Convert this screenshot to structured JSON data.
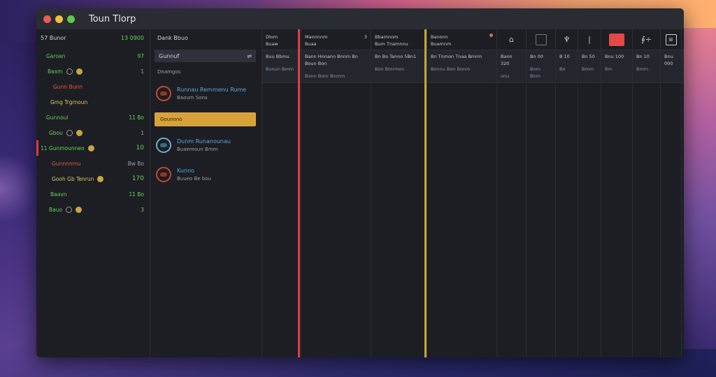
{
  "window": {
    "title": "Toun Tlorp"
  },
  "sidebar": {
    "header_left": "57 Bunor",
    "header_right": "13 0900",
    "items": [
      {
        "label": "Garoan",
        "value": "97",
        "color": "green",
        "icon": ""
      },
      {
        "label": "Baxm",
        "value": "1",
        "color": "green",
        "icon": "dots"
      },
      {
        "label": "Gunn Bunn",
        "value": "",
        "color": "red",
        "icon": ""
      },
      {
        "label": "Gmg Trgrnoun",
        "value": "",
        "color": "yellow",
        "icon": ""
      },
      {
        "label": "Gunnoul",
        "value": "11 Bo",
        "color": "green",
        "icon": ""
      },
      {
        "label": "Gbou",
        "value": "1",
        "color": "green",
        "icon": "dot"
      },
      {
        "label": "11 Gunmounneo",
        "value": "10",
        "color": "green",
        "icon": "dot"
      },
      {
        "label": "Gunnnnmu",
        "value": "Bw Bo",
        "color": "red",
        "icon": ""
      },
      {
        "label": "Gooh Gb Tenrun",
        "value": "170",
        "color": "yellow",
        "icon": "dot"
      },
      {
        "label": "Baavn",
        "value": "11 Bo",
        "color": "green",
        "icon": ""
      },
      {
        "label": "Bauo",
        "value": "3",
        "color": "green",
        "icon": "dots"
      }
    ]
  },
  "middle": {
    "header": "Dank Bbuo",
    "search_value": "Gunnuf",
    "subtitle": "Dnamgos",
    "cards": [
      {
        "title": "Runnau Remmenu Rume",
        "sub": "Baoum Sons"
      },
      {
        "title": "Dunm Runanounau",
        "sub": "Buaemoun Bmm"
      },
      {
        "title": "Kunno",
        "sub": "Buueo Be bou"
      }
    ],
    "selected_label": "Gounono"
  },
  "grid": {
    "headers": [
      {
        "l1": "Dlom",
        "l2": "Buaw"
      },
      {
        "l1": "Mannnnm",
        "l2": "Buaa",
        "n": "3"
      },
      {
        "l1": "Bbamnom",
        "l2": "Bum Tnamnnu"
      },
      {
        "l1": "Banonn",
        "l2": "Buamnm"
      }
    ],
    "icon_headers": [
      "pin-icon",
      "square-icon",
      "thumb-icon",
      "divider-icon",
      "red-box",
      "formula-icon",
      "sidebar-icon"
    ],
    "row": [
      {
        "t": "Buu Bbmu",
        "s": "Bunun Bmm"
      },
      {
        "t": "Bann Hnnann Bnnm Bn Boun Bon",
        "s": "Bonn Bonr Bnmm"
      },
      {
        "t": "Bn Bo Tanno 5Bn1",
        "s": "Bon Bmrmon"
      },
      {
        "t": "Bn Tnmon Tnaa Bmrm",
        "s": "Bonnu Bon Bonm"
      },
      {
        "t": "Bann 320",
        "s": "onu"
      },
      {
        "t": "Bn 00",
        "s": "Bnm Bnm"
      },
      {
        "t": "B 10",
        "s": "Bo"
      },
      {
        "t": "Bn 50",
        "s": "Bmm"
      },
      {
        "t": "Bnu 100",
        "s": "Bm"
      },
      {
        "t": "Bn 10",
        "s": "Bmm"
      },
      {
        "t": "Bnu 000",
        "s": ""
      }
    ]
  },
  "colors": {
    "accent_yellow": "#d8a23a",
    "accent_red": "#e14a46",
    "text_green": "#6acf5a"
  }
}
